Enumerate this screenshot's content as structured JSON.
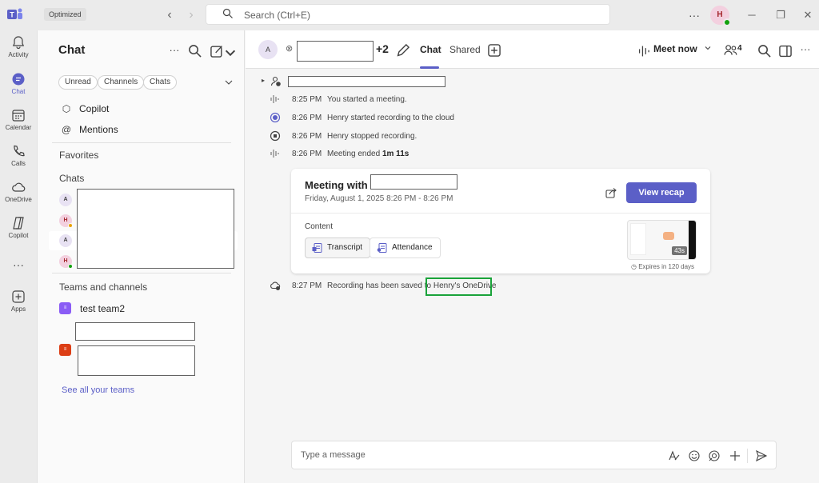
{
  "titlebar": {
    "badge": "Optimized",
    "search_placeholder": "Search (Ctrl+E)",
    "avatar_initial": "H"
  },
  "rail": {
    "items": [
      {
        "label": "Activity",
        "icon": "bell-icon"
      },
      {
        "label": "Chat",
        "icon": "chat-icon"
      },
      {
        "label": "Calendar",
        "icon": "calendar-icon"
      },
      {
        "label": "Calls",
        "icon": "phone-icon"
      },
      {
        "label": "OneDrive",
        "icon": "cloud-icon"
      },
      {
        "label": "Copilot",
        "icon": "copilot-icon"
      },
      {
        "label": "Apps",
        "icon": "plus-box-icon"
      }
    ],
    "active": "Chat"
  },
  "panel": {
    "title": "Chat",
    "filters": [
      "Unread",
      "Channels",
      "Chats"
    ],
    "nav": [
      {
        "label": "Copilot",
        "icon": "copilot-icon"
      },
      {
        "label": "Mentions",
        "icon": "at-icon"
      }
    ],
    "favorites_label": "Favorites",
    "chats_label": "Chats",
    "chat_avatars": [
      {
        "initials": "A"
      },
      {
        "initials": "H"
      },
      {
        "initials": "A"
      },
      {
        "initials": "H"
      }
    ],
    "teams_label": "Teams and channels",
    "teams": [
      {
        "name": "test team2",
        "color": "#8a5cf5"
      },
      {
        "name": "",
        "color": "#dc3e15"
      }
    ],
    "see_all": "See all your teams"
  },
  "header": {
    "avatar_initials": "A",
    "extra_participants": "+2",
    "tabs": [
      "Chat",
      "Shared"
    ],
    "active_tab": "Chat",
    "meet_now": "Meet now",
    "people_count": "4"
  },
  "events": [
    {
      "time": "8:25 PM",
      "text": "You started a meeting.",
      "icon": "meeting-audio-icon"
    },
    {
      "time": "8:26 PM",
      "text": "Henry started recording to the cloud",
      "icon": "record-icon"
    },
    {
      "time": "8:26 PM",
      "text": "Henry stopped recording.",
      "icon": "stop-record-icon"
    },
    {
      "time": "8:26 PM",
      "text": "Meeting ended",
      "bold": "1m 11s",
      "icon": "meeting-audio-icon"
    }
  ],
  "card": {
    "title": "Meeting with",
    "subtitle": "Friday, August 1, 2025 8:26 PM - 8:26 PM",
    "recap_button": "View recap",
    "content_label": "Content",
    "chips": [
      "Transcript",
      "Attendance"
    ],
    "thumb_duration": "43s",
    "expires": "Expires in 120 days"
  },
  "saved_event": {
    "time": "8:27 PM",
    "text": "Recording has been saved to",
    "link": "Henry's OneDrive"
  },
  "composer": {
    "placeholder": "Type a message"
  },
  "colors": {
    "accent": "#5b5fc7",
    "highlight": "#1aa33a"
  }
}
